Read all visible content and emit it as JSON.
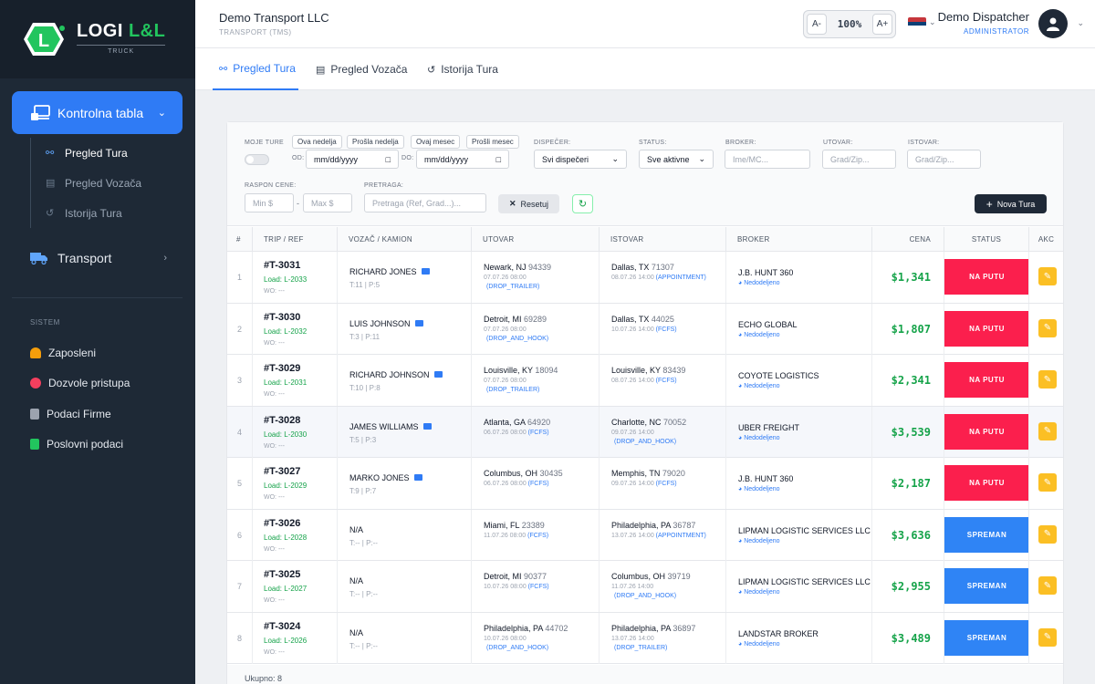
{
  "sidebar": {
    "logo_main": "LOGI",
    "logo_accent": "L&L",
    "logo_sub": "TRUCK",
    "main_item": "Kontrolna tabla",
    "sub_items": [
      {
        "label": "Pregled Tura",
        "icon": "route-icon"
      },
      {
        "label": "Pregled Vozača",
        "icon": "id-card-icon"
      },
      {
        "label": "Istorija Tura",
        "icon": "history-icon"
      }
    ],
    "transport": "Transport",
    "section_label": "SISTEM",
    "system_items": [
      {
        "label": "Zaposleni",
        "icon": "user-icon",
        "color": "#f59e0b"
      },
      {
        "label": "Dozvole pristupa",
        "icon": "key-icon",
        "color": "#f43f5e"
      },
      {
        "label": "Podaci Firme",
        "icon": "building-icon",
        "color": "#9ca3af"
      },
      {
        "label": "Poslovni podaci",
        "icon": "document-icon",
        "color": "#22c55e"
      }
    ]
  },
  "header": {
    "company": "Demo Transport LLC",
    "company_sub": "TRANSPORT (TMS)",
    "zoom_minus": "A-",
    "zoom_value": "100%",
    "zoom_plus": "A+",
    "user_name": "Demo Dispatcher",
    "user_role": "ADMINISTRATOR"
  },
  "tabs": [
    {
      "label": "Pregled Tura",
      "icon": "route-icon"
    },
    {
      "label": "Pregled Vozača",
      "icon": "id-card-icon"
    },
    {
      "label": "Istorija Tura",
      "icon": "history-icon"
    }
  ],
  "filters": {
    "my_tours": "MOJE TURE",
    "chips": [
      "Ova nedelja",
      "Prošla nedelja",
      "Ovaj mesec",
      "Prošli mesec"
    ],
    "from_label": "OD:",
    "to_label": "DO:",
    "date_placeholder": "mm/dd/yyyy",
    "dispatcher_label": "DISPEČER:",
    "dispatcher_value": "Svi dispečeri",
    "status_label": "STATUS:",
    "status_value": "Sve aktivne",
    "broker_label": "BROKER:",
    "broker_placeholder": "Ime/MC...",
    "pickup_label": "UTOVAR:",
    "pickup_placeholder": "Grad/Zip...",
    "drop_label": "ISTOVAR:",
    "drop_placeholder": "Grad/Zip...",
    "price_label": "RASPON CENE:",
    "min_placeholder": "Min $",
    "dash": "-",
    "max_placeholder": "Max $",
    "search_label": "PRETRAGA:",
    "search_placeholder": "Pretraga (Ref, Grad...)...",
    "reset": "Resetuj",
    "new_tour": "Nova Tura"
  },
  "table": {
    "headers": [
      "#",
      "TRIP / REF",
      "VOZAČ / KAMION",
      "UTOVAR",
      "ISTOVAR",
      "BROKER",
      "CENA",
      "STATUS",
      "AKC"
    ],
    "rows": [
      {
        "n": "1",
        "id": "#T-3031",
        "load": "Load: L-2033",
        "wo": "WO: ---",
        "driver": "RICHARD JONES",
        "truck": "T:11 | P:5",
        "mail": true,
        "p_city": "Newark, NJ",
        "p_zip": "94339",
        "p_date": "07.07.26 08:00",
        "p_tag": "(DROP_TRAILER)",
        "p_inline": false,
        "d_city": "Dallas, TX",
        "d_zip": "71307",
        "d_date": "08.07.26 14:00",
        "d_tag": "(APPOINTMENT)",
        "d_inline": true,
        "broker": "J.B. HUNT 360",
        "broker_sub": "Nedodeljeno",
        "price": "$1,341",
        "status": "NA PUTU",
        "status_type": "naputu"
      },
      {
        "n": "2",
        "id": "#T-3030",
        "load": "Load: L-2032",
        "wo": "WO: ---",
        "driver": "LUIS JOHNSON",
        "truck": "T:3 | P:11",
        "mail": true,
        "p_city": "Detroit, MI",
        "p_zip": "69289",
        "p_date": "07.07.26 08:00",
        "p_tag": "(DROP_AND_HOOK)",
        "p_inline": false,
        "d_city": "Dallas, TX",
        "d_zip": "44025",
        "d_date": "10.07.26 14:00",
        "d_tag": "(FCFS)",
        "d_inline": true,
        "broker": "ECHO GLOBAL",
        "broker_sub": "Nedodeljeno",
        "price": "$1,807",
        "status": "NA PUTU",
        "status_type": "naputu"
      },
      {
        "n": "3",
        "id": "#T-3029",
        "load": "Load: L-2031",
        "wo": "WO: ---",
        "driver": "RICHARD JOHNSON",
        "truck": "T:10 | P:8",
        "mail": true,
        "p_city": "Louisville, KY",
        "p_zip": "18094",
        "p_date": "07.07.26 08:00",
        "p_tag": "(DROP_TRAILER)",
        "p_inline": false,
        "d_city": "Louisville, KY",
        "d_zip": "83439",
        "d_date": "08.07.26 14:00",
        "d_tag": "(FCFS)",
        "d_inline": true,
        "broker": "COYOTE LOGISTICS",
        "broker_sub": "Nedodeljeno",
        "price": "$2,341",
        "status": "NA PUTU",
        "status_type": "naputu"
      },
      {
        "n": "4",
        "id": "#T-3028",
        "load": "Load: L-2030",
        "wo": "WO: ---",
        "driver": "JAMES WILLIAMS",
        "truck": "T:5 | P:3",
        "mail": true,
        "p_city": "Atlanta, GA",
        "p_zip": "64920",
        "p_date": "06.07.26 08:00",
        "p_tag": "(FCFS)",
        "p_inline": true,
        "d_city": "Charlotte, NC",
        "d_zip": "70052",
        "d_date": "09.07.26 14:00",
        "d_tag": "(DROP_AND_HOOK)",
        "d_inline": false,
        "broker": "UBER FREIGHT",
        "broker_sub": "Nedodeljeno",
        "price": "$3,539",
        "status": "NA PUTU",
        "status_type": "naputu"
      },
      {
        "n": "5",
        "id": "#T-3027",
        "load": "Load: L-2029",
        "wo": "WO: ---",
        "driver": "MARKO JONES",
        "truck": "T:9 | P:7",
        "mail": true,
        "p_city": "Columbus, OH",
        "p_zip": "30435",
        "p_date": "06.07.26 08:00",
        "p_tag": "(FCFS)",
        "p_inline": true,
        "d_city": "Memphis, TN",
        "d_zip": "79020",
        "d_date": "09.07.26 14:00",
        "d_tag": "(FCFS)",
        "d_inline": true,
        "broker": "J.B. HUNT 360",
        "broker_sub": "Nedodeljeno",
        "price": "$2,187",
        "status": "NA PUTU",
        "status_type": "naputu"
      },
      {
        "n": "6",
        "id": "#T-3026",
        "load": "Load: L-2028",
        "wo": "WO: ---",
        "driver": "N/A",
        "truck": "T:-- | P:--",
        "mail": false,
        "p_city": "Miami, FL",
        "p_zip": "23389",
        "p_date": "11.07.26 08:00",
        "p_tag": "(FCFS)",
        "p_inline": true,
        "d_city": "Philadelphia, PA",
        "d_zip": "36787",
        "d_date": "13.07.26 14:00",
        "d_tag": "(APPOINTMENT)",
        "d_inline": true,
        "broker": "LIPMAN LOGISTIC SERVICES LLC",
        "broker_sub": "Nedodeljeno",
        "price": "$3,636",
        "status": "SPREMAN",
        "status_type": "spreman"
      },
      {
        "n": "7",
        "id": "#T-3025",
        "load": "Load: L-2027",
        "wo": "WO: ---",
        "driver": "N/A",
        "truck": "T:-- | P:--",
        "mail": false,
        "p_city": "Detroit, MI",
        "p_zip": "90377",
        "p_date": "10.07.26 08:00",
        "p_tag": "(FCFS)",
        "p_inline": true,
        "d_city": "Columbus, OH",
        "d_zip": "39719",
        "d_date": "11.07.26 14:00",
        "d_tag": "(DROP_AND_HOOK)",
        "d_inline": false,
        "broker": "LIPMAN LOGISTIC SERVICES LLC",
        "broker_sub": "Nedodeljeno",
        "price": "$2,955",
        "status": "SPREMAN",
        "status_type": "spreman"
      },
      {
        "n": "8",
        "id": "#T-3024",
        "load": "Load: L-2026",
        "wo": "WO: ---",
        "driver": "N/A",
        "truck": "T:-- | P:--",
        "mail": false,
        "p_city": "Philadelphia, PA",
        "p_zip": "44702",
        "p_date": "10.07.26 08:00",
        "p_tag": "(DROP_AND_HOOK)",
        "p_inline": false,
        "d_city": "Philadelphia, PA",
        "d_zip": "36897",
        "d_date": "13.07.26 14:00",
        "d_tag": "(DROP_TRAILER)",
        "d_inline": false,
        "broker": "LANDSTAR BROKER",
        "broker_sub": "Nedodeljeno",
        "price": "$3,489",
        "status": "SPREMAN",
        "status_type": "spreman"
      }
    ],
    "total": "Ukupno: 8"
  },
  "colors": {
    "accent": "#2f7bf5",
    "sidebar_bg": "#1e2936",
    "status_on_road": "#fb1f4d",
    "status_ready": "#2f84f5",
    "price": "#16a34a",
    "edit_button": "#fbbf24"
  }
}
